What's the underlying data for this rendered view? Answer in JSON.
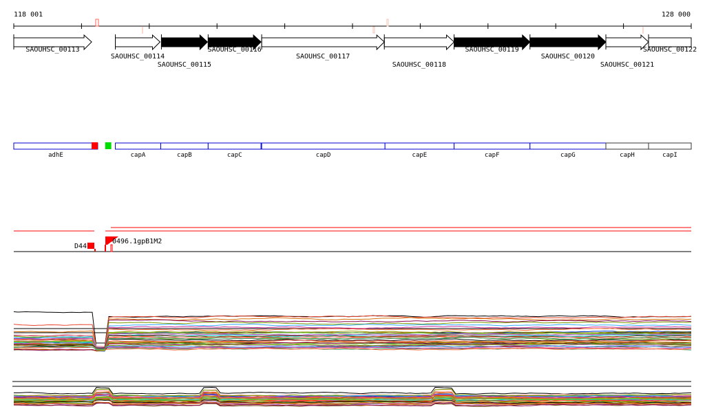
{
  "ruler": {
    "start_label": "118 001",
    "end_label": "128 000",
    "start": 118001,
    "end": 128000
  },
  "genes": [
    {
      "name": "SAOUHSC_00113",
      "start": 118001,
      "end": 119150,
      "strand": "+",
      "style": "open"
    },
    {
      "name": "SAOUHSC_00114",
      "start": 119500,
      "end": 120160,
      "strand": "+",
      "style": "open"
    },
    {
      "name": "SAOUHSC_00115",
      "start": 120180,
      "end": 120860,
      "strand": "+",
      "style": "filled"
    },
    {
      "name": "SAOUHSC_00116",
      "start": 120870,
      "end": 121650,
      "strand": "+",
      "style": "filled"
    },
    {
      "name": "SAOUHSC_00117",
      "start": 121660,
      "end": 123470,
      "strand": "+",
      "style": "open"
    },
    {
      "name": "SAOUHSC_00118",
      "start": 123470,
      "end": 124500,
      "strand": "+",
      "style": "open"
    },
    {
      "name": "SAOUHSC_00119",
      "start": 124500,
      "end": 125620,
      "strand": "+",
      "style": "filled"
    },
    {
      "name": "SAOUHSC_00120",
      "start": 125620,
      "end": 126740,
      "strand": "+",
      "style": "filled"
    },
    {
      "name": "SAOUHSC_00121",
      "start": 126740,
      "end": 127370,
      "strand": "+",
      "style": "open"
    },
    {
      "name": "SAOUHSC_00122",
      "start": 127370,
      "end": 128000,
      "strand": "none",
      "style": "open"
    }
  ],
  "annotations": [
    {
      "name": "adhE",
      "start": 118001,
      "end": 119240,
      "border": "#0000cc"
    },
    {
      "name": "capA",
      "start": 119500,
      "end": 120170,
      "border": "#0000cc"
    },
    {
      "name": "capB",
      "start": 120170,
      "end": 120870,
      "border": "#0000cc"
    },
    {
      "name": "capC",
      "start": 120870,
      "end": 121650,
      "border": "#0000cc"
    },
    {
      "name": "capD",
      "start": 121660,
      "end": 123480,
      "border": "#0000cc"
    },
    {
      "name": "capE",
      "start": 123480,
      "end": 124500,
      "border": "#0000cc"
    },
    {
      "name": "capF",
      "start": 124500,
      "end": 125620,
      "border": "#0000cc"
    },
    {
      "name": "capG",
      "start": 125620,
      "end": 126740,
      "border": "#0000cc"
    },
    {
      "name": "capH",
      "start": 126740,
      "end": 127370,
      "border": "#333333"
    },
    {
      "name": "capI",
      "start": 127370,
      "end": 128000,
      "border": "#333333"
    }
  ],
  "markers": [
    {
      "color": "#ff0000",
      "start": 119150,
      "end": 119240
    },
    {
      "color": "#00dd00",
      "start": 119350,
      "end": 119440
    }
  ],
  "features": {
    "label_d44": "D44",
    "label_overlap": "0496.1gpB1M2",
    "color": "#ff0000"
  },
  "trace_colors": [
    "#000000",
    "#e8452c",
    "#d4700c",
    "#8b0a50",
    "#7a9a01",
    "#33aaff",
    "#cc3399",
    "#ff6633",
    "#999900",
    "#66cc33",
    "#aa66cc",
    "#663300",
    "#ff9999",
    "#339966",
    "#0033cc",
    "#cc6600",
    "#996699",
    "#00cccc",
    "#ff3300",
    "#669900"
  ]
}
